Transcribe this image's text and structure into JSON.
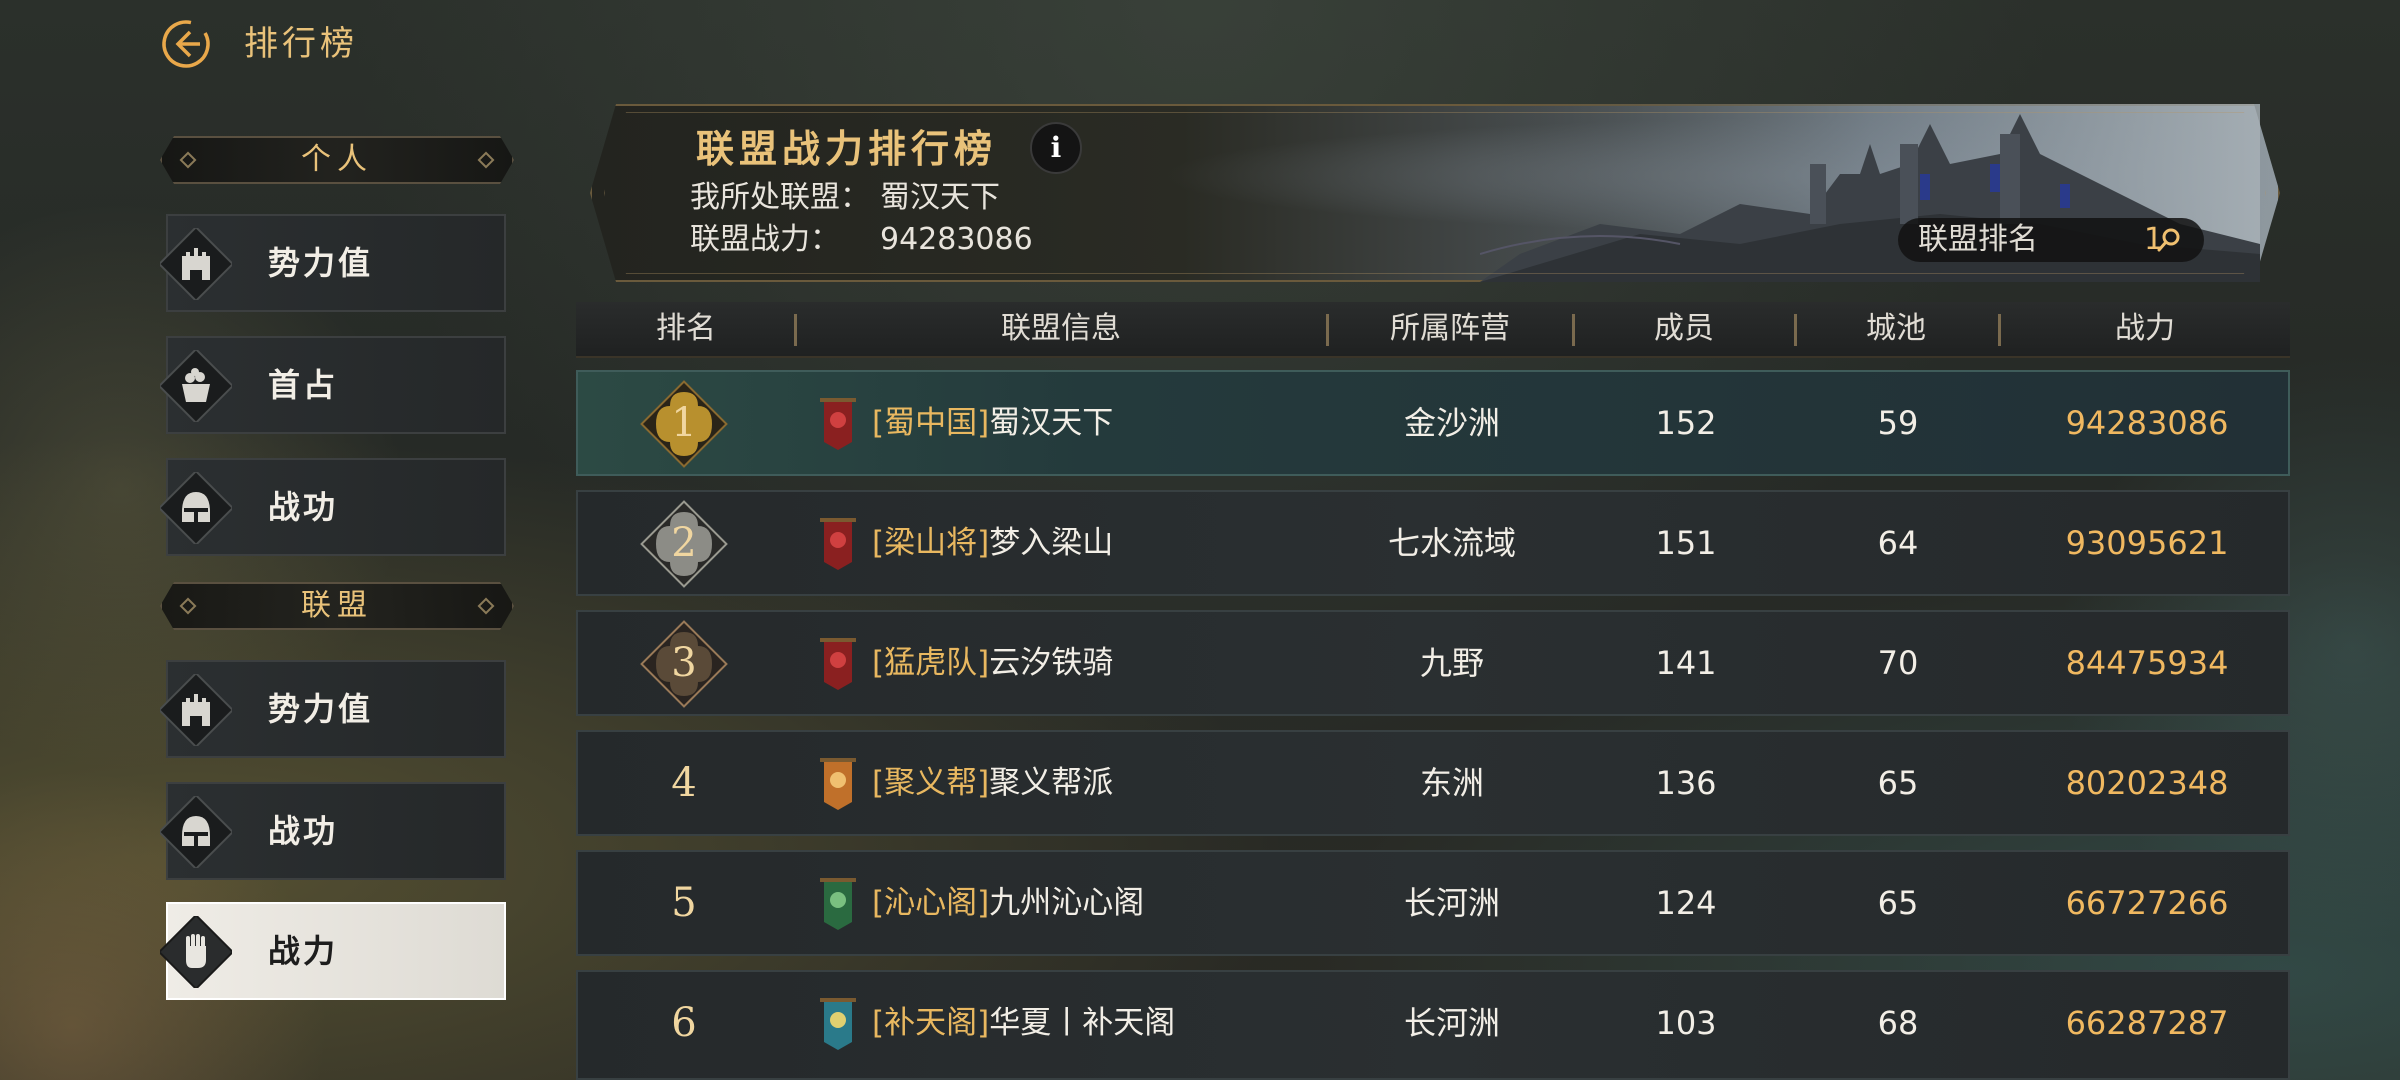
{
  "page": {
    "title": "排行榜"
  },
  "nav": {
    "personal_header": "个人",
    "personal_items": [
      {
        "label": "势力值",
        "icon": "castle-icon"
      },
      {
        "label": "首占",
        "icon": "treasure-icon"
      },
      {
        "label": "战功",
        "icon": "helmet-icon"
      }
    ],
    "alliance_header": "联盟",
    "alliance_items": [
      {
        "label": "势力值",
        "icon": "castle-icon"
      },
      {
        "label": "战功",
        "icon": "helmet-icon"
      },
      {
        "label": "战力",
        "icon": "fist-icon",
        "active": true
      }
    ]
  },
  "banner": {
    "title": "联盟战力排行榜",
    "my_alliance_label": "我所处联盟：",
    "my_alliance_value": "蜀汉天下",
    "power_label": "联盟战力：",
    "power_value": "94283086",
    "rank_label": "联盟排名",
    "rank_value": "1"
  },
  "table": {
    "headers": [
      "排名",
      "联盟信息",
      "所属阵营",
      "成员",
      "城池",
      "战力"
    ],
    "rows": [
      {
        "rank": "1",
        "tag": "[蜀中国]",
        "name": "蜀汉天下",
        "camp": "金沙洲",
        "members": "152",
        "cities": "59",
        "power": "94283086"
      },
      {
        "rank": "2",
        "tag": "[梁山将]",
        "name": "梦入梁山",
        "camp": "七水流域",
        "members": "151",
        "cities": "64",
        "power": "93095621"
      },
      {
        "rank": "3",
        "tag": "[猛虎队]",
        "name": "云汐铁骑",
        "camp": "九野",
        "members": "141",
        "cities": "70",
        "power": "84475934"
      },
      {
        "rank": "4",
        "tag": "[聚义帮]",
        "name": "聚义帮派",
        "camp": "东洲",
        "members": "136",
        "cities": "65",
        "power": "80202348"
      },
      {
        "rank": "5",
        "tag": "[沁心阁]",
        "name": "九州沁心阁",
        "camp": "长河洲",
        "members": "124",
        "cities": "65",
        "power": "66727266"
      },
      {
        "rank": "6",
        "tag": "[补天阁]",
        "name": "华夏丨补天阁",
        "camp": "长河洲",
        "members": "103",
        "cities": "68",
        "power": "66287287"
      }
    ]
  },
  "colors": {
    "accent_gold": "#e9c27a",
    "power": "#f0b860",
    "gold_badge": "#b8902e",
    "silver_badge": "#8c8c86",
    "bronze_badge": "#5a4a38"
  }
}
